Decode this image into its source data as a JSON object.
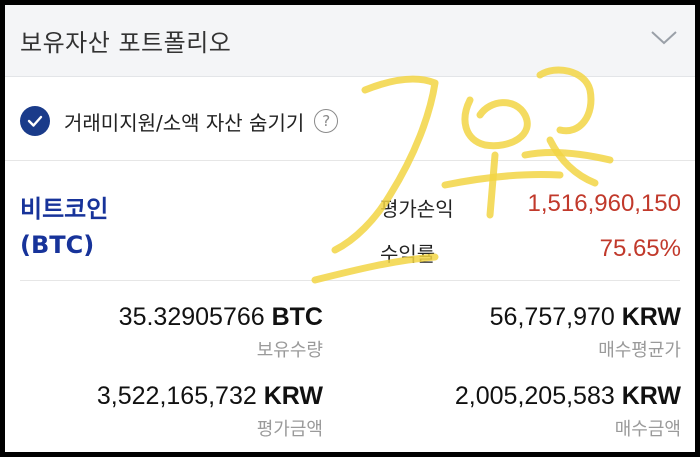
{
  "header": {
    "title": "보유자산 포트폴리오"
  },
  "filter": {
    "hide_label": "거래미지원/소액 자산 숨기기",
    "help_glyph": "?"
  },
  "coin": {
    "name": "비트코인",
    "ticker": "(BTC)"
  },
  "metrics": [
    {
      "label": "평가손익",
      "value": "1,516,960,150"
    },
    {
      "label": "수익률",
      "value": "75.65%"
    }
  ],
  "holdings": {
    "quantity": {
      "amount": "35.32905766",
      "unit": "BTC",
      "label": "보유수량"
    },
    "avg_price": {
      "amount": "56,757,970",
      "unit": "KRW",
      "label": "매수평균가"
    },
    "eval_amount": {
      "amount": "3,522,165,732",
      "unit": "KRW",
      "label": "평가금액"
    },
    "buy_amount": {
      "amount": "2,005,205,583",
      "unit": "KRW",
      "label": "매수금액"
    }
  },
  "colors": {
    "accent": "#17339a",
    "profit": "#c1392b",
    "signature": "#f2d544"
  },
  "icons": {
    "expand": "chevron-down-icon",
    "check": "check-icon",
    "help": "help-circle-icon"
  }
}
